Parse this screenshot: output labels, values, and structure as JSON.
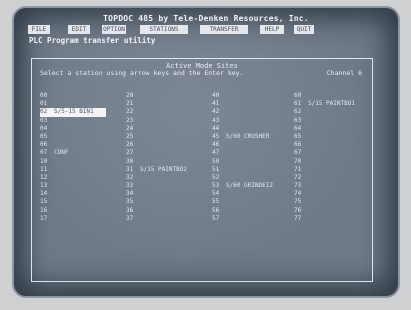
{
  "app": {
    "title": "TOPDOC 485 by Tele-Denken Resources, Inc.",
    "subtitle": "PLC Program transfer utility"
  },
  "menu": {
    "items": [
      "FILE",
      "EDIT",
      "OPTION",
      "STATIONS",
      "TRANSFER",
      "HELP",
      "QUIT"
    ]
  },
  "panel": {
    "title": "Active Mode Sites",
    "instruction": "Select a station using arrow keys and the Enter key.",
    "channel": "Channel 6"
  },
  "columns": [
    {
      "rows": [
        {
          "num": "00",
          "name": ""
        },
        {
          "num": "01",
          "name": ""
        },
        {
          "num": "02",
          "name": "S/5-15  BIN1",
          "selected": true
        },
        {
          "num": "03",
          "name": ""
        },
        {
          "num": "04",
          "name": ""
        },
        {
          "num": "05",
          "name": ""
        },
        {
          "num": "06",
          "name": ""
        },
        {
          "num": "07",
          "name": "CONF"
        },
        {
          "num": "10",
          "name": ""
        },
        {
          "num": "11",
          "name": ""
        },
        {
          "num": "12",
          "name": ""
        },
        {
          "num": "13",
          "name": ""
        },
        {
          "num": "14",
          "name": ""
        },
        {
          "num": "15",
          "name": ""
        },
        {
          "num": "16",
          "name": ""
        },
        {
          "num": "17",
          "name": ""
        }
      ]
    },
    {
      "rows": [
        {
          "num": "20",
          "name": ""
        },
        {
          "num": "21",
          "name": ""
        },
        {
          "num": "22",
          "name": ""
        },
        {
          "num": "23",
          "name": ""
        },
        {
          "num": "24",
          "name": ""
        },
        {
          "num": "25",
          "name": ""
        },
        {
          "num": "26",
          "name": ""
        },
        {
          "num": "27",
          "name": ""
        },
        {
          "num": "30",
          "name": ""
        },
        {
          "num": "31",
          "name": "S/15  PAINTBO2"
        },
        {
          "num": "32",
          "name": ""
        },
        {
          "num": "33",
          "name": ""
        },
        {
          "num": "34",
          "name": ""
        },
        {
          "num": "35",
          "name": ""
        },
        {
          "num": "36",
          "name": ""
        },
        {
          "num": "37",
          "name": ""
        }
      ]
    },
    {
      "rows": [
        {
          "num": "40",
          "name": ""
        },
        {
          "num": "41",
          "name": ""
        },
        {
          "num": "42",
          "name": ""
        },
        {
          "num": "43",
          "name": ""
        },
        {
          "num": "44",
          "name": ""
        },
        {
          "num": "45",
          "name": "S/60  CRUSHER"
        },
        {
          "num": "46",
          "name": ""
        },
        {
          "num": "47",
          "name": ""
        },
        {
          "num": "50",
          "name": ""
        },
        {
          "num": "51",
          "name": ""
        },
        {
          "num": "52",
          "name": ""
        },
        {
          "num": "53",
          "name": "S/60  GRINDE12"
        },
        {
          "num": "54",
          "name": ""
        },
        {
          "num": "55",
          "name": ""
        },
        {
          "num": "56",
          "name": ""
        },
        {
          "num": "57",
          "name": ""
        }
      ]
    },
    {
      "rows": [
        {
          "num": "60",
          "name": ""
        },
        {
          "num": "61",
          "name": "S/15  PAINTBO1"
        },
        {
          "num": "62",
          "name": ""
        },
        {
          "num": "63",
          "name": ""
        },
        {
          "num": "64",
          "name": ""
        },
        {
          "num": "65",
          "name": ""
        },
        {
          "num": "66",
          "name": ""
        },
        {
          "num": "67",
          "name": ""
        },
        {
          "num": "70",
          "name": ""
        },
        {
          "num": "71",
          "name": ""
        },
        {
          "num": "72",
          "name": ""
        },
        {
          "num": "73",
          "name": ""
        },
        {
          "num": "74",
          "name": ""
        },
        {
          "num": "75",
          "name": ""
        },
        {
          "num": "76",
          "name": ""
        },
        {
          "num": "77",
          "name": ""
        }
      ]
    }
  ]
}
